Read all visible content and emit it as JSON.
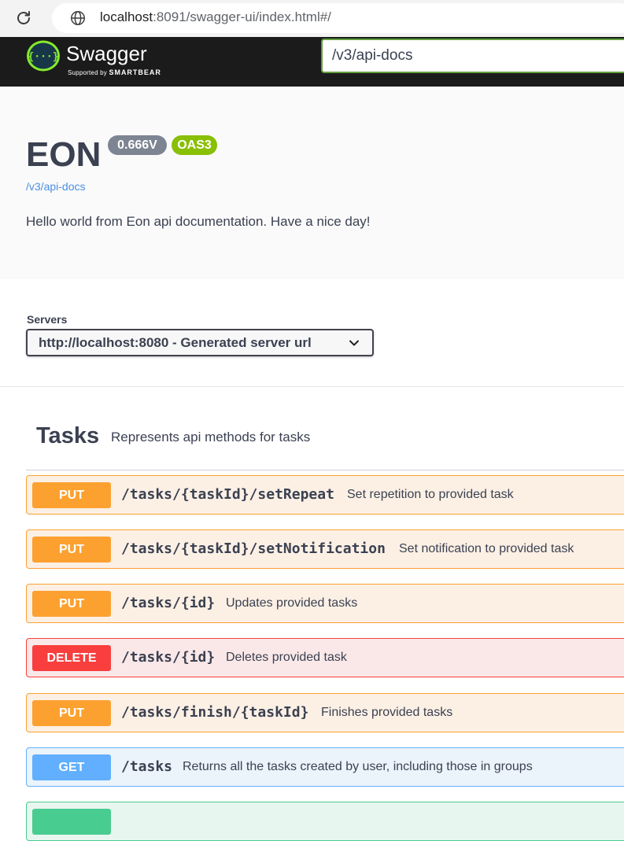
{
  "browser": {
    "url_host": "localhost",
    "url_rest": ":8091/swagger-ui/index.html#/",
    "reload_icon": "reload-icon",
    "site_icon": "globe-icon"
  },
  "topbar": {
    "logo_title": "Swagger",
    "logo_sub_prefix": "Supported by",
    "logo_sub_brand": "SMARTBEAR",
    "logo_glyph": "{···}",
    "spec_url": "/v3/api-docs"
  },
  "info": {
    "title": "EON",
    "version": "0.666V",
    "oas": "OAS3",
    "spec_link": "/v3/api-docs",
    "description": "Hello world from Eon api documentation. Have a nice day!"
  },
  "servers": {
    "label": "Servers",
    "selected": "http://localhost:8080 - Generated server url"
  },
  "tag": {
    "name": "Tasks",
    "description": "Represents api methods for tasks"
  },
  "operations": [
    {
      "method": "PUT",
      "path": "/tasks/{taskId}/setRepeat",
      "summary": "Set repetition to provided task"
    },
    {
      "method": "PUT",
      "path": "/tasks/{taskId}/setNotification",
      "summary": "Set notification to provided task"
    },
    {
      "method": "PUT",
      "path": "/tasks/{id}",
      "summary": "Updates provided tasks"
    },
    {
      "method": "DELETE",
      "path": "/tasks/{id}",
      "summary": "Deletes provided task"
    },
    {
      "method": "PUT",
      "path": "/tasks/finish/{taskId}",
      "summary": "Finishes provided tasks"
    },
    {
      "method": "GET",
      "path": "/tasks",
      "summary": "Returns all the tasks created by user, including those in groups"
    },
    {
      "method": "",
      "path": "",
      "summary": ""
    }
  ],
  "colors": {
    "put": "#fca130",
    "delete": "#f93e3e",
    "get": "#61affe",
    "post": "#49cc90",
    "oas_badge": "#89bf04",
    "version_badge": "#7d8492",
    "topbar": "#1b1b1b"
  }
}
